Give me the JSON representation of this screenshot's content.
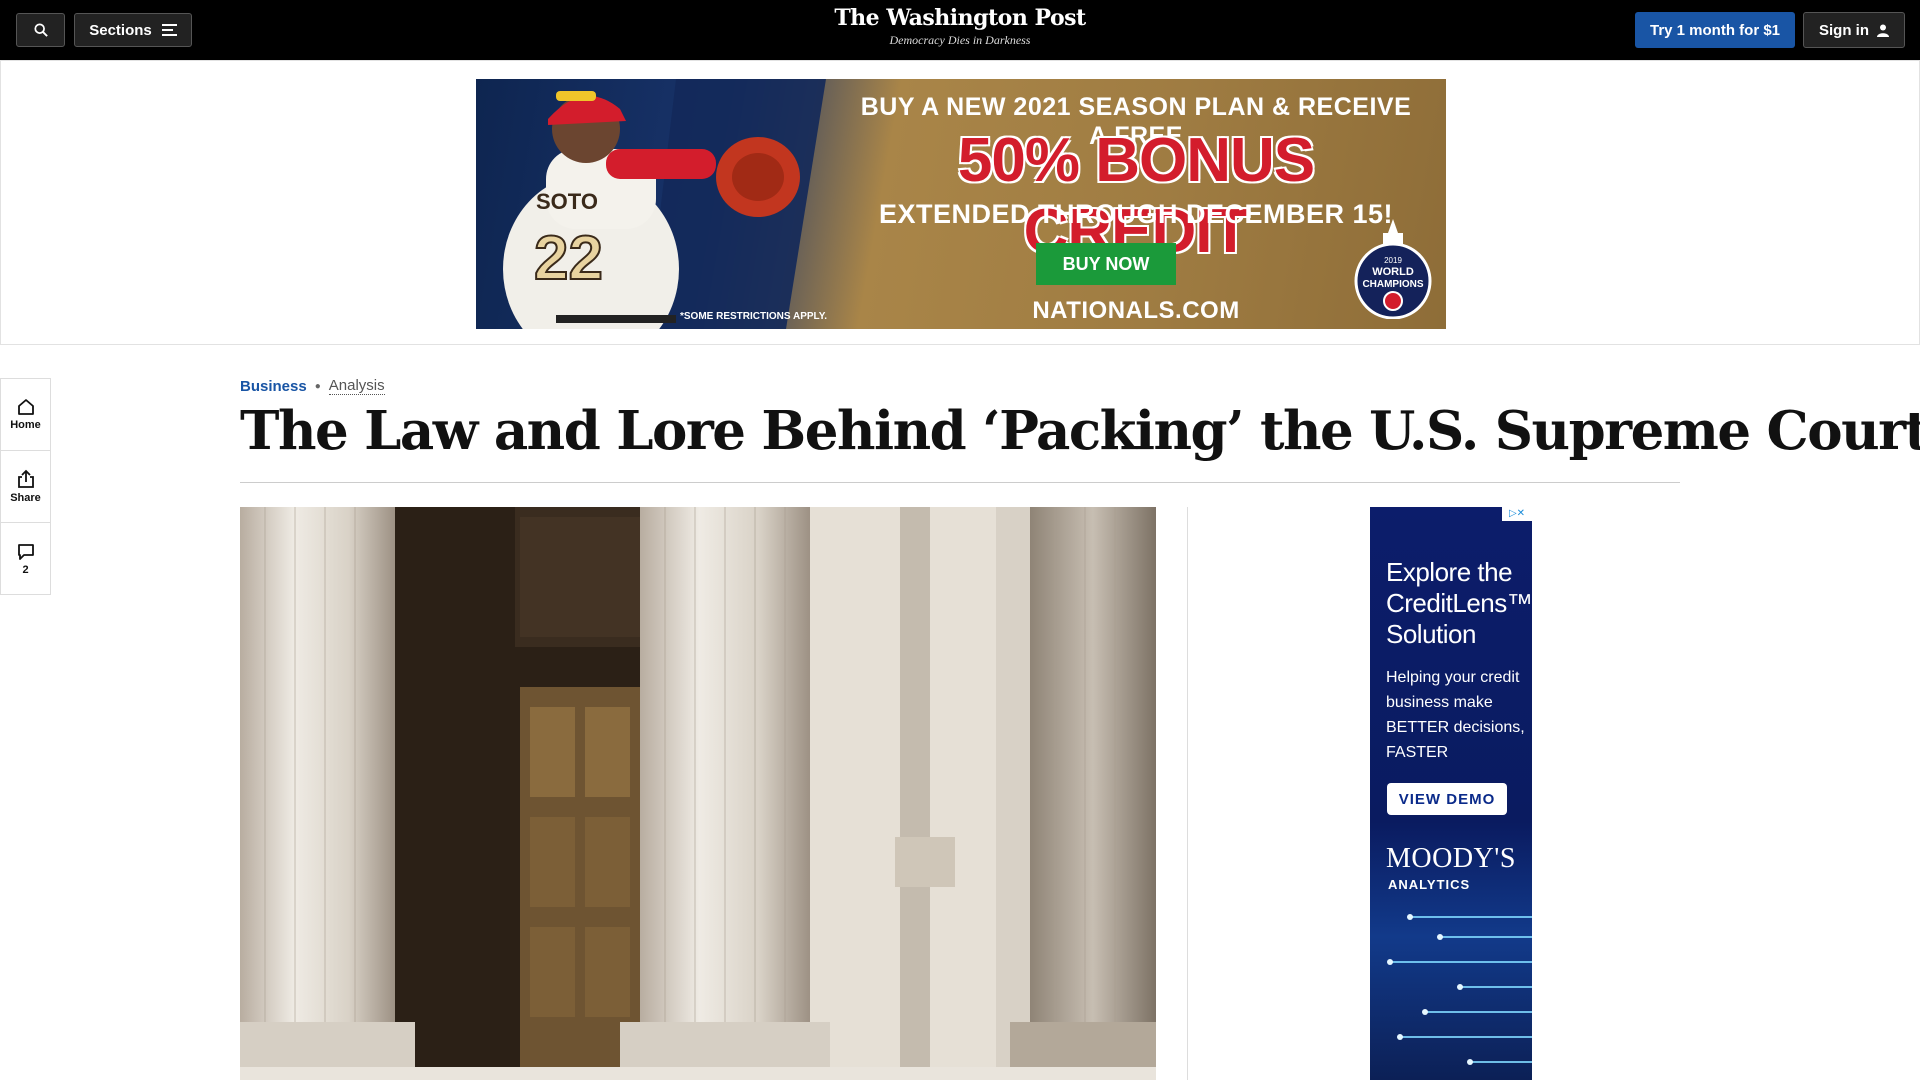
{
  "nav": {
    "sections_label": "Sections",
    "masthead_logo": "The Washington Post",
    "masthead_tagline": "Democracy Dies in Darkness",
    "try_label": "Try 1 month for $1",
    "signin_label": "Sign in"
  },
  "banner_ad": {
    "line1": "BUY A NEW 2021 SEASON PLAN & RECEIVE A FREE",
    "line2": "50% BONUS CREDIT",
    "line3": "EXTENDED THROUGH DECEMBER 15!",
    "cta": "BUY NOW",
    "site": "NATIONALS.COM",
    "fine_print": "*SOME RESTRICTIONS APPLY.",
    "jersey_name": "SOTO",
    "jersey_number": "22",
    "badge_year": "2019",
    "badge_line1": "WORLD",
    "badge_line2": "CHAMPIONS",
    "colors": {
      "red": "#d31d2c",
      "green": "#1b9a3a",
      "navy": "#0e2550",
      "gold": "#a98548"
    }
  },
  "rail": {
    "home_label": "Home",
    "share_label": "Share",
    "comments_count": "2"
  },
  "article": {
    "section": "Business",
    "label": "Analysis",
    "headline": "The Law and Lore Behind ‘Packing’ the U.S. Supreme Court"
  },
  "side_ad": {
    "headline": "Explore the CreditLens™ Solution",
    "body": "Helping your credit business make BETTER decisions, FASTER",
    "cta": "VIEW DEMO",
    "brand": "MOODY'S",
    "brand_sub": "ANALYTICS"
  },
  "theme": {
    "accent_blue": "#1955a5",
    "nav_background": "#000000"
  }
}
